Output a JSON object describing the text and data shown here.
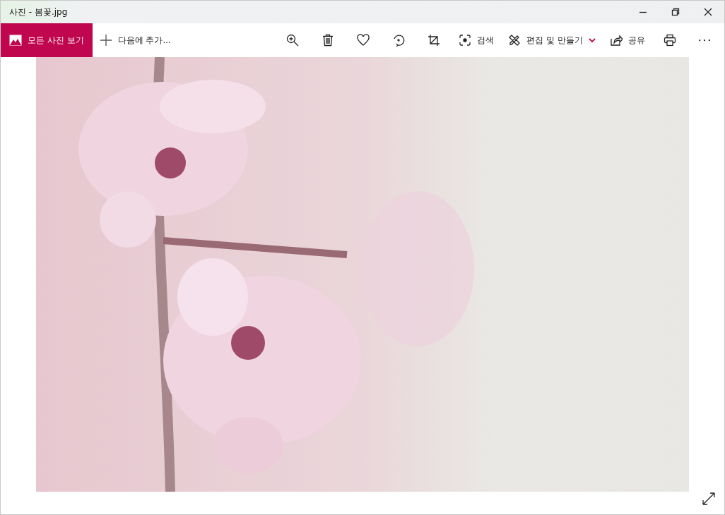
{
  "window": {
    "title": "사진 - 봄꽃.jpg"
  },
  "toolbar": [
    {
      "kind": "primary",
      "label": "모든 사진 보기"
    },
    {
      "kind": "text",
      "label": "다음에 추가..."
    },
    {
      "kind": "icon"
    },
    {
      "kind": "icon"
    },
    {
      "kind": "icon"
    },
    {
      "kind": "icon"
    },
    {
      "kind": "icon"
    },
    {
      "kind": "text",
      "label": "검색"
    },
    {
      "kind": "dropdown",
      "label": "편집 및 만들기"
    },
    {
      "kind": "text",
      "label": "공유"
    },
    {
      "kind": "icon"
    },
    {
      "kind": "icon"
    }
  ]
}
